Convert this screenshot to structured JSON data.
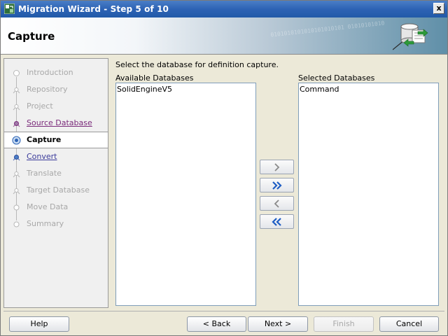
{
  "window": {
    "title": "Migration Wizard - Step 5 of 10",
    "close_label": "x"
  },
  "header": {
    "page_title": "Capture",
    "decoration_text": "0101010101010101010101 01010101010"
  },
  "steps": [
    {
      "label": "Introduction",
      "state": "disabled"
    },
    {
      "label": "Repository",
      "state": "disabled"
    },
    {
      "label": "Project",
      "state": "disabled"
    },
    {
      "label": "Source Database",
      "state": "visited"
    },
    {
      "label": "Capture",
      "state": "current"
    },
    {
      "label": "Convert",
      "state": "link"
    },
    {
      "label": "Translate",
      "state": "disabled"
    },
    {
      "label": "Target Database",
      "state": "disabled"
    },
    {
      "label": "Move Data",
      "state": "disabled"
    },
    {
      "label": "Summary",
      "state": "disabled"
    }
  ],
  "main": {
    "instruction": "Select the database for definition capture.",
    "available_label": "Available Databases",
    "available_items": [
      "SolidEngineV5"
    ],
    "selected_label": "Selected Databases",
    "selected_items": [
      "Command"
    ]
  },
  "shuttle_icons": [
    "move-right-icon",
    "move-all-right-icon",
    "move-left-icon",
    "move-all-left-icon"
  ],
  "buttons": {
    "help": "Help",
    "back": "< Back",
    "next": "Next >",
    "finish": "Finish",
    "cancel": "Cancel"
  },
  "colors": {
    "title_bar": "#2d63b5",
    "link": "#3a3a9a",
    "visited": "#7a2a7a",
    "disabled_text": "#a8a8a8"
  }
}
